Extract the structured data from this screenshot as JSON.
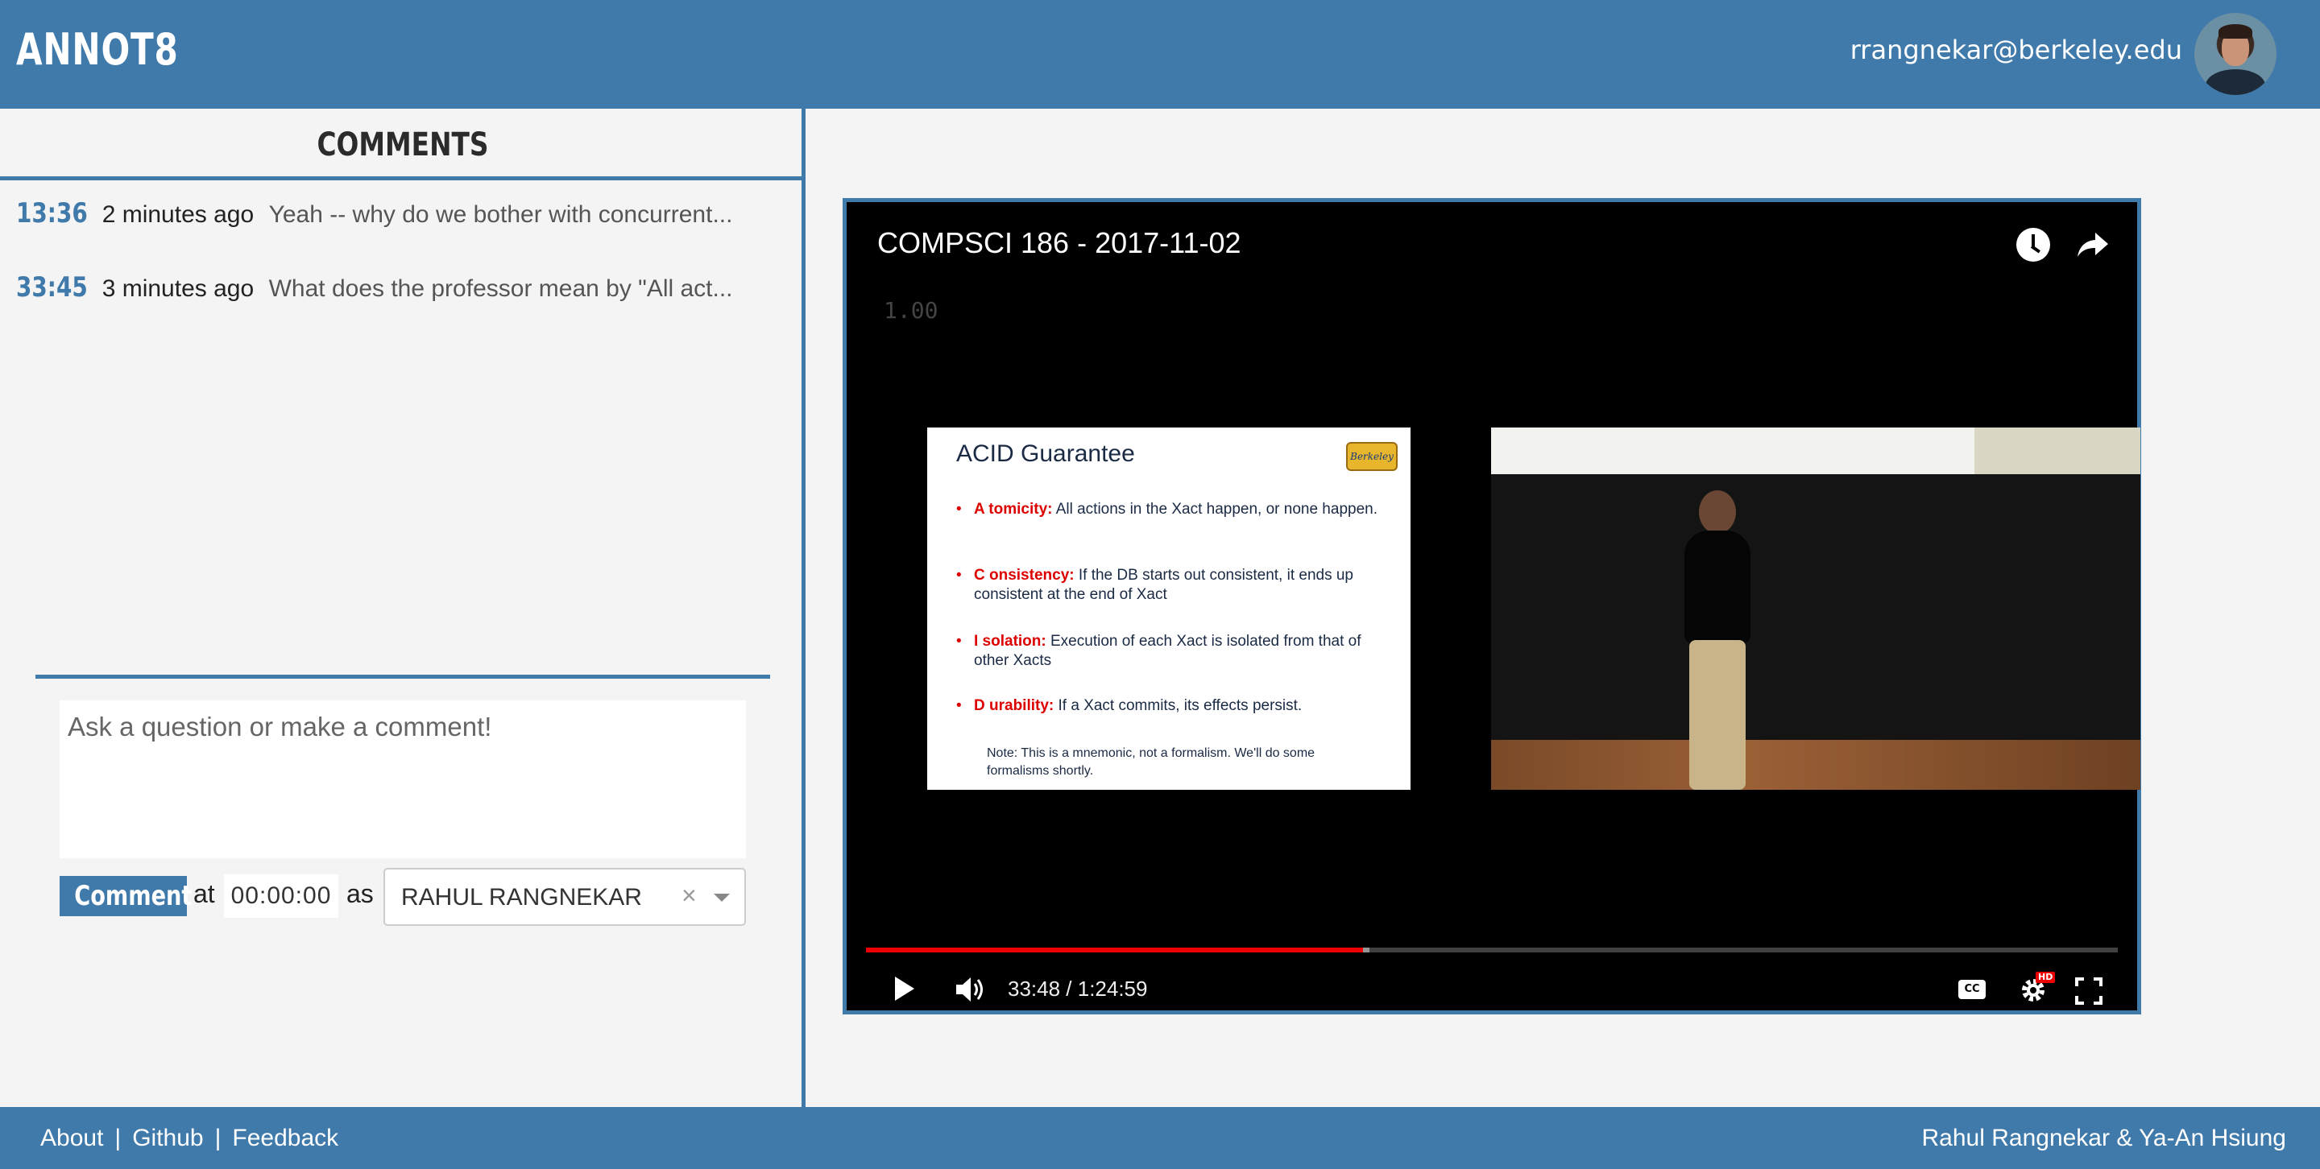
{
  "header": {
    "logo": "ANNOT8",
    "user_email": "rrangnekar@berkeley.edu"
  },
  "sidebar": {
    "title": "COMMENTS",
    "comments": [
      {
        "time": "13:36",
        "ago": "2 minutes ago",
        "text": "Yeah -- why do we bother with concurrent..."
      },
      {
        "time": "33:45",
        "ago": "3 minutes ago",
        "text": "What does the professor mean by \"All act..."
      }
    ],
    "compose": {
      "placeholder": "Ask a question or make a comment!",
      "button_label": "Comment",
      "at_label": "at",
      "timestamp": "00:00:00",
      "as_label": "as",
      "author": "RAHUL RANGNEKAR",
      "clear_glyph": "×"
    }
  },
  "player": {
    "title": "COMPSCI 186 - 2017-11-02",
    "speed_label": "1.00",
    "current_time": "33:48",
    "duration": "1:24:59",
    "time_display": "33:48 / 1:24:59",
    "progress": 0.397,
    "buffered": 0.402,
    "cc_label": "CC",
    "hd_label": "HD",
    "slide": {
      "title": "ACID Guarantee",
      "badge": "Berkeley",
      "bullets": [
        {
          "key": "A tomicity:",
          "rest": " All actions in the Xact happen, or none happen."
        },
        {
          "key": "C onsistency:",
          "rest": " If the DB starts out consistent, it ends up consistent at the end of Xact"
        },
        {
          "key": "I solation:",
          "rest": " Execution of each Xact is isolated from that of other Xacts"
        },
        {
          "key": "D urability:",
          "rest": " If a Xact commits, its effects persist."
        }
      ],
      "note": "Note: This is a mnemonic, not a formalism. We'll do some formalisms shortly."
    },
    "icons": [
      "clock-icon",
      "share-icon",
      "play-icon",
      "volume-icon",
      "cc-icon",
      "gear-icon",
      "fullscreen-icon"
    ]
  },
  "footer": {
    "links": [
      "About",
      "Github",
      "Feedback"
    ],
    "separator": "|",
    "credits": "Rahul Rangnekar & Ya-An Hsiung"
  },
  "colors": {
    "brand": "#3f7aab",
    "progress": "#ee0000",
    "background": "#f4f4f4"
  }
}
